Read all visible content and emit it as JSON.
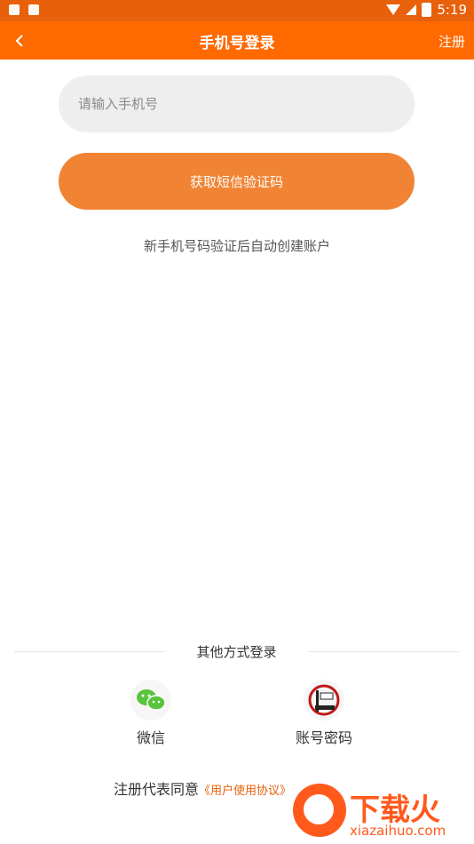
{
  "status_bar": {
    "time": "5:19"
  },
  "app_bar": {
    "title": "手机号登录",
    "right_action": "注册"
  },
  "form": {
    "phone_placeholder": "请输入手机号",
    "sms_button": "获取短信验证码",
    "hint": "新手机号码验证后自动创建账户"
  },
  "other_login": {
    "title": "其他方式登录",
    "options": [
      {
        "label": "微信",
        "icon": "wechat-icon"
      },
      {
        "label": "账号密码",
        "icon": "account-password-icon"
      }
    ]
  },
  "agreement": {
    "prefix": "注册代表同意",
    "link": "《用户使用协议》"
  },
  "watermark": {
    "brand": "下载火",
    "url": "xiazaihuo.com"
  },
  "colors": {
    "status_bar": "#e8600a",
    "app_bar": "#ff6a00",
    "button": "#f08434",
    "input_bg": "#eeeeee"
  }
}
